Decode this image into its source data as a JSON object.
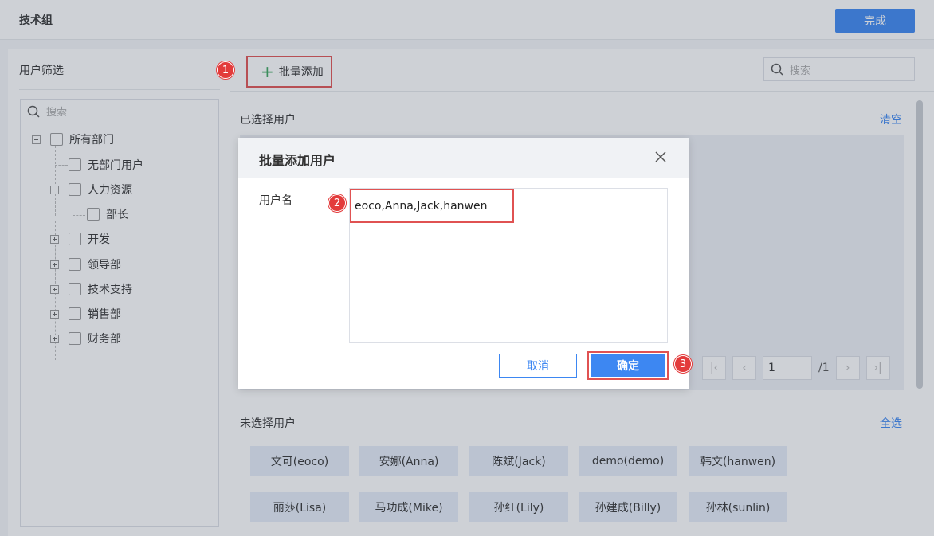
{
  "header": {
    "title": "技术组",
    "done_label": "完成"
  },
  "left_panel": {
    "title": "用户筛选",
    "search_placeholder": "搜索",
    "tree": [
      {
        "label": "所有部门"
      },
      {
        "label": "无部门用户"
      },
      {
        "label": "人力资源"
      },
      {
        "label": "部长"
      },
      {
        "label": "开发"
      },
      {
        "label": "领导部"
      },
      {
        "label": "技术支持"
      },
      {
        "label": "销售部"
      },
      {
        "label": "财务部"
      }
    ]
  },
  "toolbar": {
    "batch_add_label": "批量添加",
    "search_placeholder": "搜索"
  },
  "selected": {
    "title": "已选择用户",
    "clear_label": "清空"
  },
  "pager": {
    "page": "1",
    "total": "/1"
  },
  "unselected": {
    "title": "未选择用户",
    "select_all_label": "全选",
    "users": [
      "文可(eoco)",
      "安娜(Anna)",
      "陈斌(Jack)",
      "demo(demo)",
      "韩文(hanwen)",
      "丽莎(Lisa)",
      "马功成(Mike)",
      "孙红(Lily)",
      "孙建成(Billy)",
      "孙林(sunlin)"
    ]
  },
  "dialog": {
    "title": "批量添加用户",
    "field_label": "用户名",
    "value": "eoco,Anna,Jack,hanwen",
    "cancel_label": "取消",
    "ok_label": "确定"
  },
  "badges": [
    "1",
    "2",
    "3"
  ],
  "colors": {
    "primary": "#3d87f2",
    "highlight": "#e05252",
    "badge": "#e33b3b",
    "add_icon": "#3ba55c"
  }
}
